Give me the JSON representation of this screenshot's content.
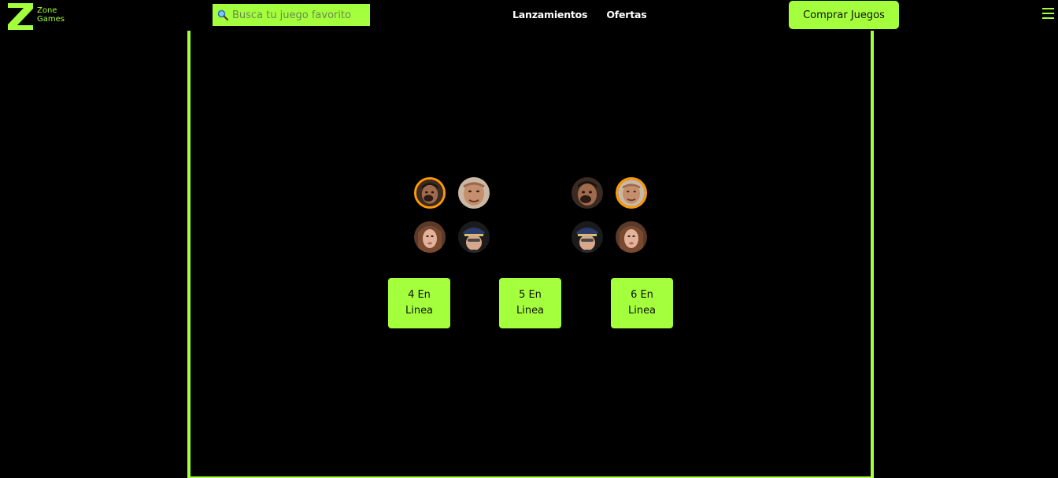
{
  "brand": {
    "line1": "Zone",
    "line2": "Games",
    "accent_color": "#a4ff3c"
  },
  "search": {
    "placeholder": "Busca tu juego favorito",
    "icon": "magnifier-icon"
  },
  "nav": {
    "releases": "Lanzamientos",
    "offers": "Ofertas"
  },
  "buy_button": "Comprar Juegos",
  "menu_icon": "hamburger-icon",
  "players": {
    "left": [
      "face-1",
      "face-2",
      "face-3",
      "police-face"
    ],
    "right": [
      "face-1",
      "face-2",
      "police-face",
      "face-3"
    ],
    "left_selected": "face-1",
    "right_selected": "face-2",
    "selected_color": "#ff9900"
  },
  "modes": [
    {
      "label": "4 En Linea"
    },
    {
      "label": "5 En Linea"
    },
    {
      "label": "6 En Linea"
    }
  ]
}
